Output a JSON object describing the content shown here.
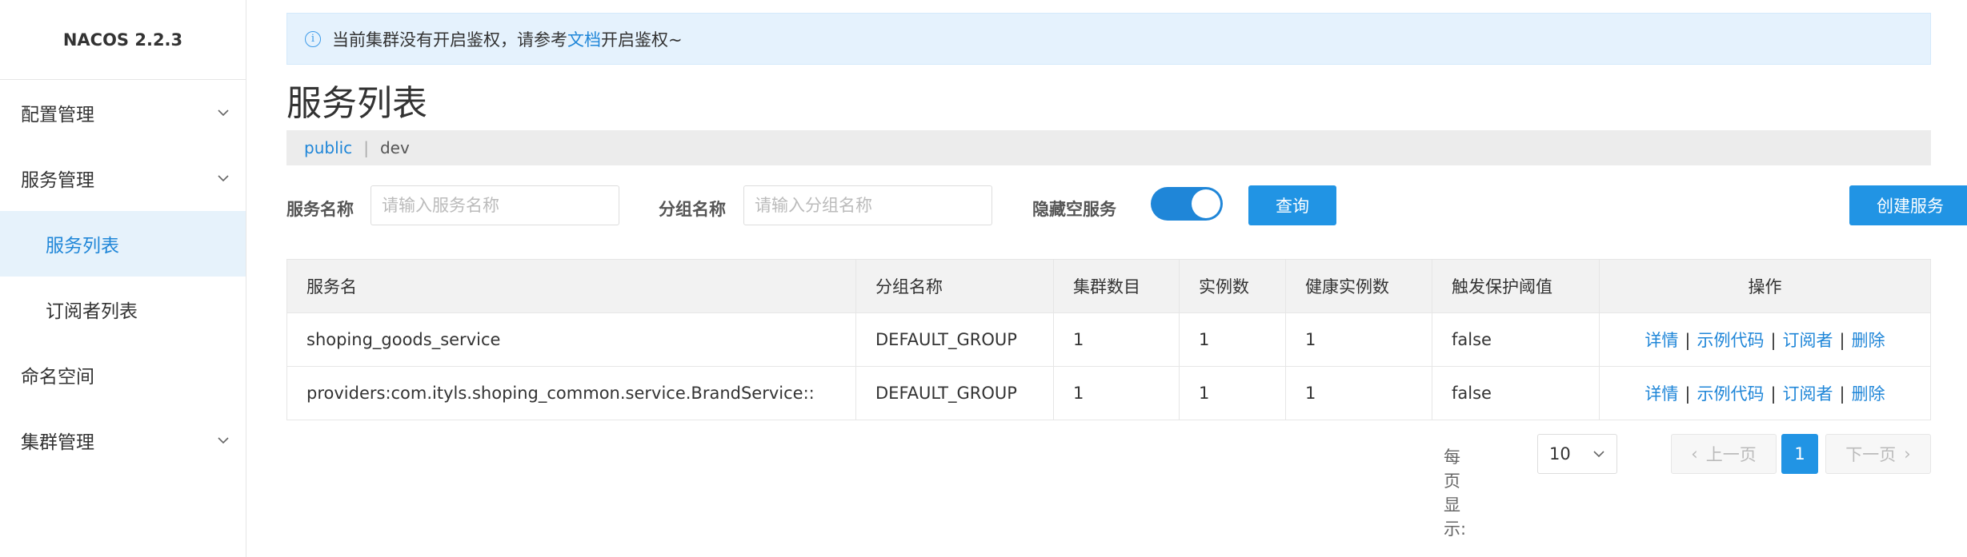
{
  "app": {
    "brand": "NACOS 2.2.3"
  },
  "sidebar": {
    "items": [
      {
        "label": "配置管理",
        "expandable": true
      },
      {
        "label": "服务管理",
        "expandable": true
      },
      {
        "label": "服务列表",
        "active": true,
        "sub": true
      },
      {
        "label": "订阅者列表",
        "sub": true
      },
      {
        "label": "命名空间"
      },
      {
        "label": "集群管理",
        "expandable": true
      }
    ]
  },
  "alert": {
    "prefix": "当前集群没有开启鉴权，请参考",
    "link": "文档",
    "suffix": "开启鉴权~",
    "icon": "info-icon"
  },
  "page": {
    "title": "服务列表"
  },
  "namespaces": {
    "active": "public",
    "separator": "|",
    "other": "dev"
  },
  "filters": {
    "service_name_label": "服务名称",
    "service_name_placeholder": "请输入服务名称",
    "group_name_label": "分组名称",
    "group_name_placeholder": "请输入分组名称",
    "hide_empty_label": "隐藏空服务",
    "hide_empty_on": true,
    "query_button": "查询",
    "create_button": "创建服务"
  },
  "table": {
    "columns": [
      "服务名",
      "分组名称",
      "集群数目",
      "实例数",
      "健康实例数",
      "触发保护阈值",
      "操作"
    ],
    "rows": [
      [
        "shoping_goods_service",
        "DEFAULT_GROUP",
        "1",
        "1",
        "1",
        "false"
      ],
      [
        "providers:com.ityls.shoping_common.service.BrandService::",
        "DEFAULT_GROUP",
        "1",
        "1",
        "1",
        "false"
      ]
    ],
    "operations": [
      "详情",
      "示例代码",
      "订阅者",
      "删除"
    ],
    "op_separator": "|"
  },
  "pagination": {
    "per_page_label": "每页显示:",
    "per_page_value": "10",
    "prev": "上一页",
    "next": "下一页",
    "current": "1"
  },
  "colors": {
    "accent": "#2194e4",
    "link": "#1f86d8",
    "alert_bg": "#e5f2fd"
  }
}
